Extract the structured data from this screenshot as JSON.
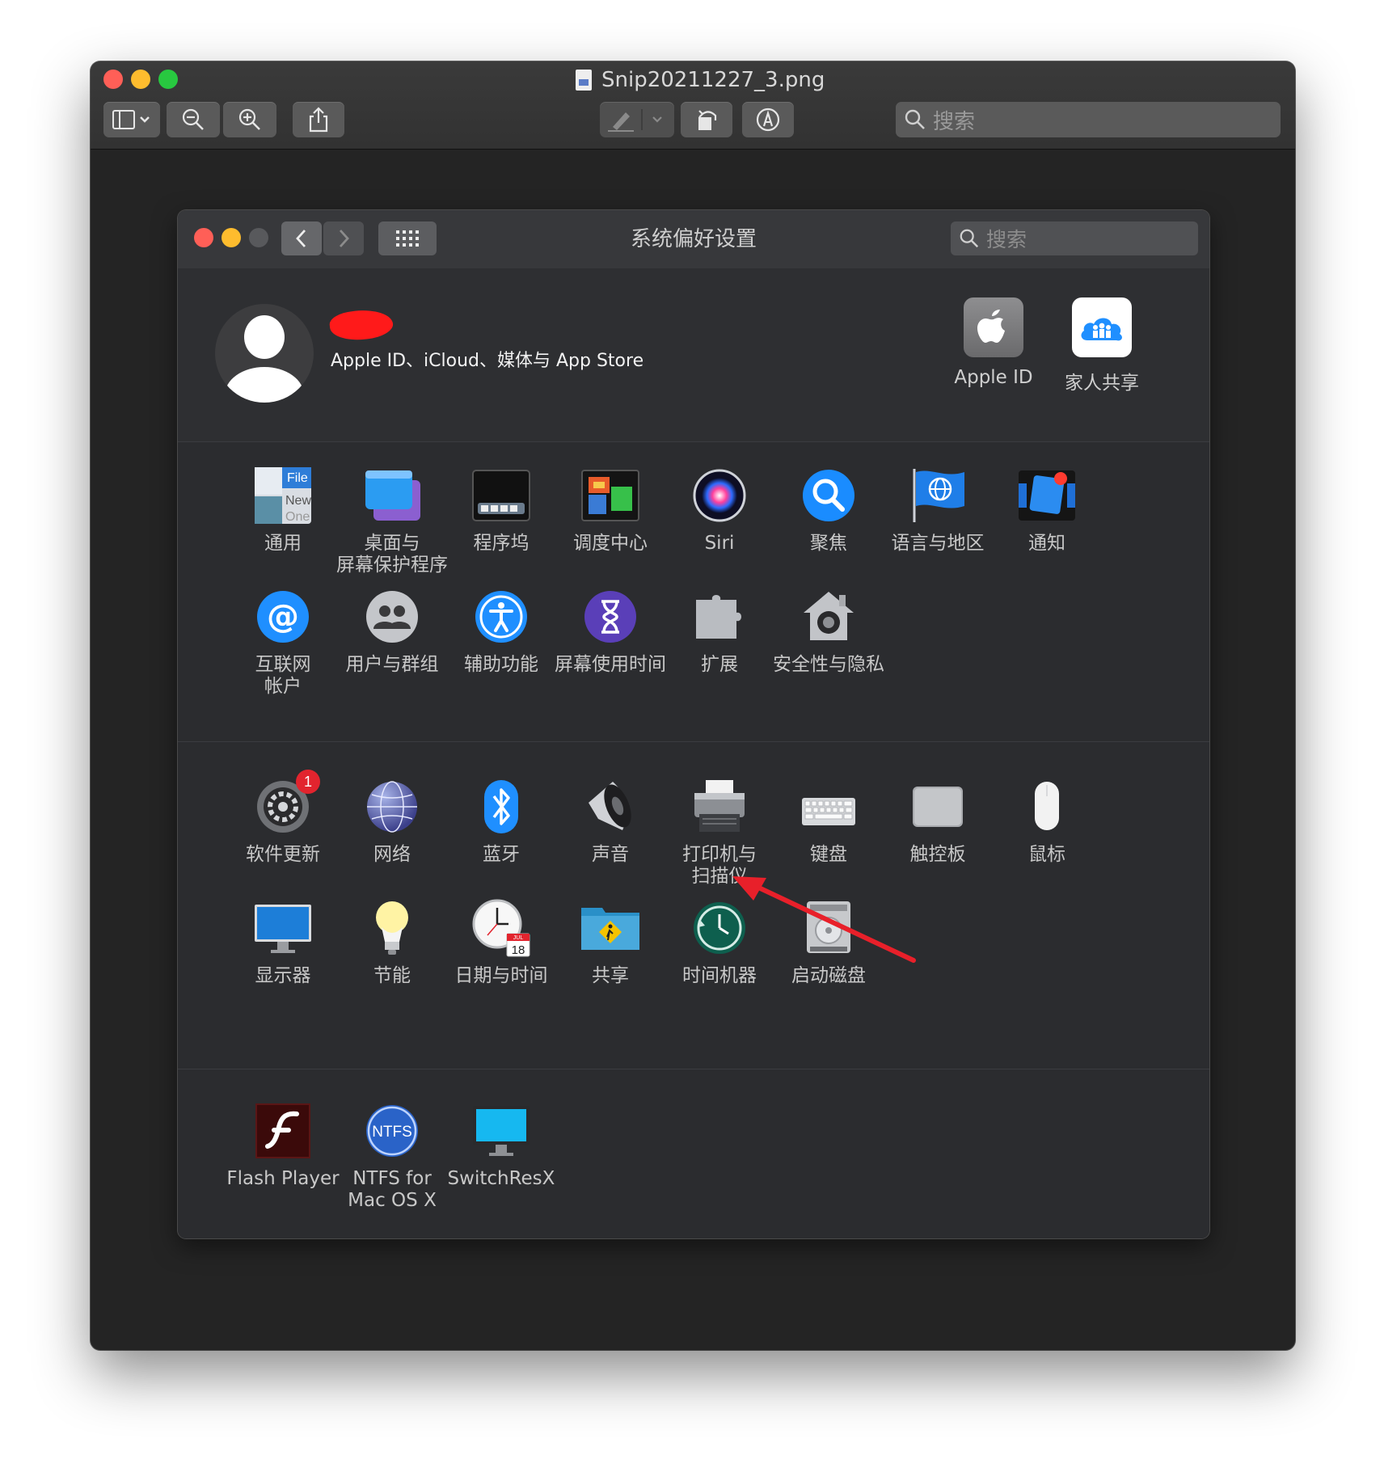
{
  "preview_window": {
    "title": "Snip20211227_3.png",
    "search_placeholder": "搜索"
  },
  "sysprefs": {
    "title": "系统偏好设置",
    "search_placeholder": "搜索",
    "account_subtitle": "Apple ID、iCloud、媒体与 App Store",
    "top_panes": [
      {
        "label": "Apple ID",
        "icon": "apple-logo-icon"
      },
      {
        "label": "家人共享",
        "icon": "family-sharing-icon"
      }
    ],
    "section1": [
      {
        "label": "通用",
        "icon": "general-icon"
      },
      {
        "label": "桌面与\n屏幕保护程序",
        "icon": "desktop-screensaver-icon"
      },
      {
        "label": "程序坞",
        "icon": "dock-icon"
      },
      {
        "label": "调度中心",
        "icon": "mission-control-icon"
      },
      {
        "label": "Siri",
        "icon": "siri-icon"
      },
      {
        "label": "聚焦",
        "icon": "spotlight-icon"
      },
      {
        "label": "语言与地区",
        "icon": "language-region-icon"
      },
      {
        "label": "通知",
        "icon": "notifications-icon"
      },
      {
        "label": "互联网\n帐户",
        "icon": "internet-accounts-icon"
      },
      {
        "label": "用户与群组",
        "icon": "users-groups-icon"
      },
      {
        "label": "辅助功能",
        "icon": "accessibility-icon"
      },
      {
        "label": "屏幕使用时间",
        "icon": "screen-time-icon"
      },
      {
        "label": "扩展",
        "icon": "extensions-icon"
      },
      {
        "label": "安全性与隐私",
        "icon": "security-privacy-icon"
      }
    ],
    "section2": [
      {
        "label": "软件更新",
        "icon": "software-update-icon",
        "badge": "1"
      },
      {
        "label": "网络",
        "icon": "network-icon"
      },
      {
        "label": "蓝牙",
        "icon": "bluetooth-icon"
      },
      {
        "label": "声音",
        "icon": "sound-icon"
      },
      {
        "label": "打印机与\n扫描仪",
        "icon": "printers-scanners-icon"
      },
      {
        "label": "键盘",
        "icon": "keyboard-icon"
      },
      {
        "label": "触控板",
        "icon": "trackpad-icon"
      },
      {
        "label": "鼠标",
        "icon": "mouse-icon"
      },
      {
        "label": "显示器",
        "icon": "displays-icon"
      },
      {
        "label": "节能",
        "icon": "energy-saver-icon"
      },
      {
        "label": "日期与时间",
        "icon": "date-time-icon"
      },
      {
        "label": "共享",
        "icon": "sharing-icon"
      },
      {
        "label": "时间机器",
        "icon": "time-machine-icon"
      },
      {
        "label": "启动磁盘",
        "icon": "startup-disk-icon"
      }
    ],
    "section3": [
      {
        "label": "Flash Player",
        "icon": "flash-player-icon"
      },
      {
        "label": "NTFS for\nMac OS X",
        "icon": "ntfs-icon",
        "icon_text": "NTFS"
      },
      {
        "label": "SwitchResX",
        "icon": "switchresx-icon"
      }
    ],
    "icon_glyphs": {
      "general_file": "File",
      "general_new": "New",
      "general_one": "One",
      "calendar_month": "JUL",
      "calendar_day": "18"
    }
  },
  "annotation": {
    "arrow_color": "#e8202a"
  },
  "colors": {
    "accent_blue": "#1a8cff",
    "close": "#ff5f57",
    "minimize": "#febc2e",
    "zoom": "#28c840"
  }
}
